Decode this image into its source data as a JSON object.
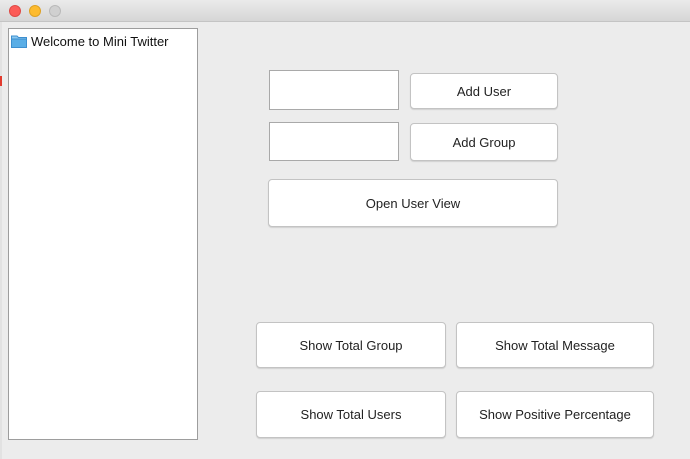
{
  "tree": {
    "root_label": "Welcome to Mini Twitter"
  },
  "user_input": {
    "value": ""
  },
  "group_input": {
    "value": ""
  },
  "buttons": {
    "add_user": "Add User",
    "add_group": "Add Group",
    "open_user_view": "Open User View",
    "show_total_group": "Show Total Group",
    "show_total_message": "Show Total Message",
    "show_total_users": "Show Total Users",
    "show_positive_percentage": "Show Positive Percentage"
  },
  "colors": {
    "close": "#fc5b57",
    "minimize": "#fdbb2e",
    "zoom_inactive": "#d0d0d0",
    "folder": "#5aaee6"
  }
}
